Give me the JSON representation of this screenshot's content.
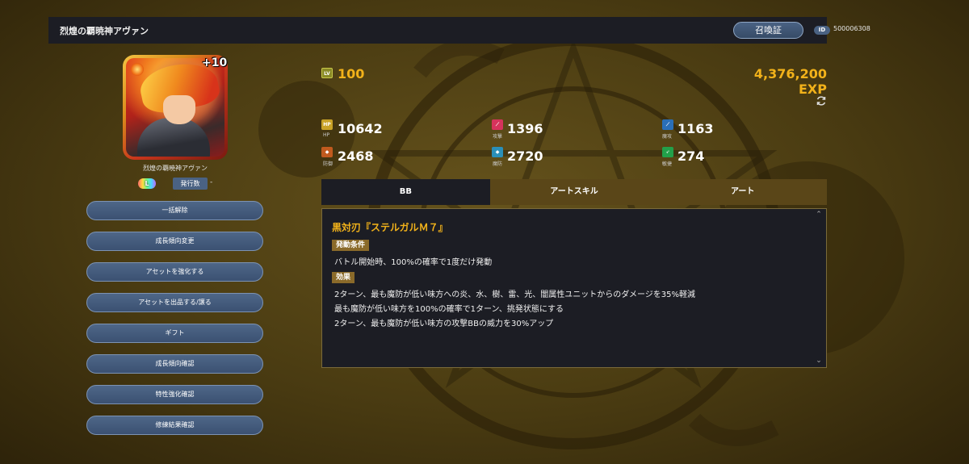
{
  "header": {
    "title": "烈煌の覇暁神アヴァン",
    "summon_label": "召喚証",
    "id_label": "ID",
    "id_value": "500006308"
  },
  "unit": {
    "plus_label": "+10",
    "name": "烈煌の覇暁神アヴァン",
    "rarity_label": "L",
    "issue_label": "発行数",
    "issue_value": "-"
  },
  "menu": [
    {
      "label": "一括解除"
    },
    {
      "label": "成長傾向変更"
    },
    {
      "label": "アセットを強化する"
    },
    {
      "label": "アセットを出品する/譲る"
    },
    {
      "label": "ギフト"
    },
    {
      "label": "成長傾向確認"
    },
    {
      "label": "特性強化確認"
    },
    {
      "label": "修練結果確認"
    }
  ],
  "level": {
    "icon_label": "LV",
    "value": "100",
    "exp": "4,376,200 EXP"
  },
  "stats": [
    {
      "icon": "HP",
      "label": "HP",
      "value": "10642",
      "color": "#c9a227"
    },
    {
      "icon": "",
      "label": "攻撃",
      "value": "1396",
      "color": "#d6335c"
    },
    {
      "icon": "",
      "label": "魔攻",
      "value": "1163",
      "color": "#2a6fb8"
    },
    {
      "icon": "",
      "label": "防御",
      "value": "2468",
      "color": "#c05a1e"
    },
    {
      "icon": "",
      "label": "魔防",
      "value": "2720",
      "color": "#2a8fb8"
    },
    {
      "icon": "",
      "label": "敏捷",
      "value": "274",
      "color": "#22a04a"
    }
  ],
  "tabs": [
    {
      "label": "BB"
    },
    {
      "label": "アートスキル"
    },
    {
      "label": "アート"
    }
  ],
  "skill": {
    "name": "黒対刃『ステルガルＭ７』",
    "condition_tag": "発動条件",
    "condition": "バトル開始時、100%の確率で1度だけ発動",
    "effect_tag": "効果",
    "effects": [
      "2ターン、最も魔防が低い味方への炎、水、樹、雷、光、闇属性ユニットからのダメージを35%軽減",
      "最も魔防が低い味方を100%の確率で1ターン、挑発状態にする",
      "2ターン、最も魔防が低い味方の攻撃BBの威力を30%アップ"
    ]
  },
  "colors": {
    "accent": "#f2b21a",
    "panel": "#1c1d24",
    "button": "#4a6283"
  }
}
